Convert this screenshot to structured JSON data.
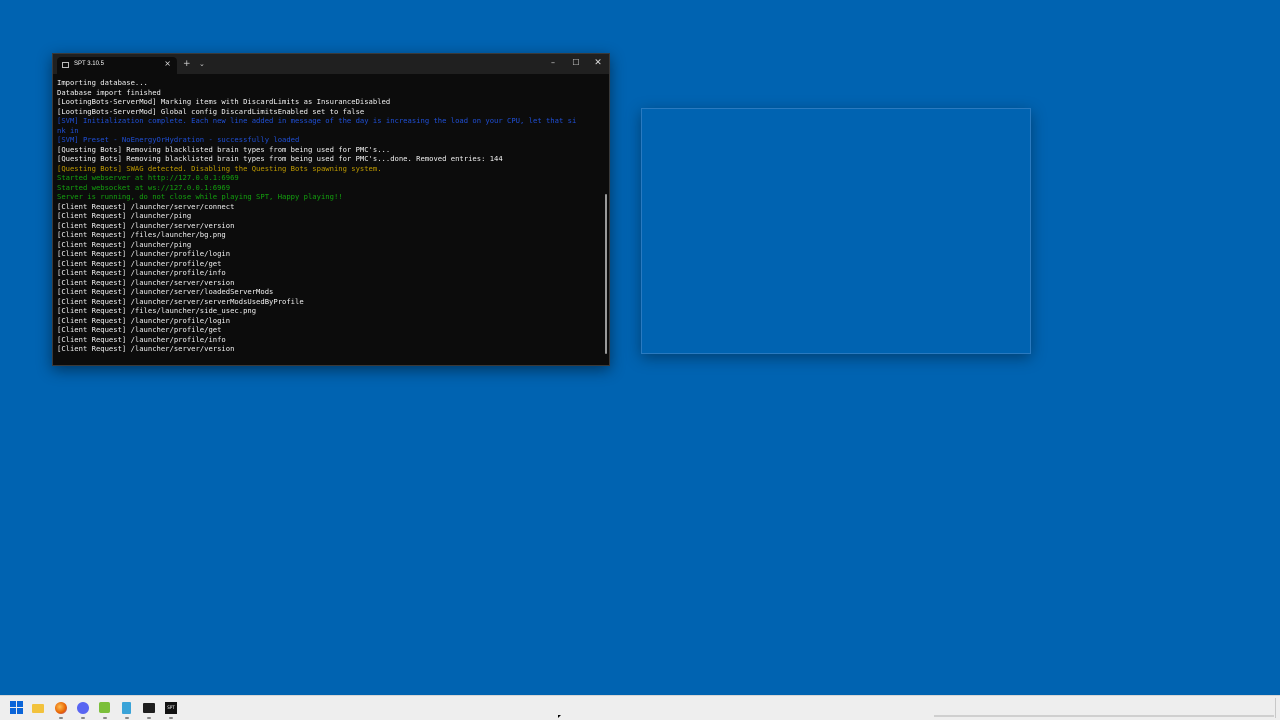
{
  "terminal": {
    "tab_title": "SPT 3.10.5",
    "tab_close": "×",
    "new_tab": "+",
    "dropdown": "⌄",
    "minimize": "–",
    "maximize": "☐",
    "close": "✕",
    "lines": [
      {
        "text": "Importing database...",
        "color": "white"
      },
      {
        "text": "Database import finished",
        "color": "white"
      },
      {
        "text": "[LootingBots-ServerMod] Marking items with DiscardLimits as InsuranceDisabled",
        "color": "white"
      },
      {
        "text": "[LootingBots-ServerMod] Global config DiscardLimitsEnabled set to false",
        "color": "white"
      },
      {
        "text": "[SVM] Initialization complete. Each new line added in message of the day is increasing the load on your CPU, let that si",
        "color": "blue"
      },
      {
        "text": "nk in",
        "color": "blue"
      },
      {
        "text": "[SVM] Preset - NoEnergyOrHydration - successfully loaded",
        "color": "blue"
      },
      {
        "text": "[Questing Bots] Removing blacklisted brain types from being used for PMC's...",
        "color": "white"
      },
      {
        "text": "[Questing Bots] Removing blacklisted brain types from being used for PMC's...done. Removed entries: 144",
        "color": "white"
      },
      {
        "text": "[Questing Bots] SWAG detected. Disabling the Questing Bots spawning system.",
        "color": "yellow"
      },
      {
        "text": "Started webserver at http://127.0.0.1:6969",
        "color": "green"
      },
      {
        "text": "Started websocket at ws://127.0.0.1:6969",
        "color": "green"
      },
      {
        "text": "Server is running, do not close while playing SPT, Happy playing!!",
        "color": "green"
      },
      {
        "text": "[Client Request] /launcher/server/connect",
        "color": "white"
      },
      {
        "text": "[Client Request] /launcher/ping",
        "color": "white"
      },
      {
        "text": "[Client Request] /launcher/server/version",
        "color": "white"
      },
      {
        "text": "[Client Request] /files/launcher/bg.png",
        "color": "white"
      },
      {
        "text": "[Client Request] /launcher/ping",
        "color": "white"
      },
      {
        "text": "[Client Request] /launcher/profile/login",
        "color": "white"
      },
      {
        "text": "[Client Request] /launcher/profile/get",
        "color": "white"
      },
      {
        "text": "[Client Request] /launcher/profile/info",
        "color": "white"
      },
      {
        "text": "[Client Request] /launcher/server/version",
        "color": "white"
      },
      {
        "text": "[Client Request] /launcher/server/loadedServerMods",
        "color": "white"
      },
      {
        "text": "[Client Request] /launcher/server/serverModsUsedByProfile",
        "color": "white"
      },
      {
        "text": "[Client Request] /files/launcher/side_usec.png",
        "color": "white"
      },
      {
        "text": "[Client Request] /launcher/profile/login",
        "color": "white"
      },
      {
        "text": "[Client Request] /launcher/profile/get",
        "color": "white"
      },
      {
        "text": "[Client Request] /launcher/profile/info",
        "color": "white"
      },
      {
        "text": "[Client Request] /launcher/server/version",
        "color": "white"
      }
    ]
  },
  "taskbar": {
    "items": [
      {
        "name": "start-icon"
      },
      {
        "name": "file-explorer-icon"
      },
      {
        "name": "firefox-icon"
      },
      {
        "name": "discord-icon"
      },
      {
        "name": "green-app-icon"
      },
      {
        "name": "notepad-icon"
      },
      {
        "name": "terminal-icon"
      },
      {
        "name": "spt-icon",
        "label": "SPT"
      }
    ]
  },
  "colors": {
    "desktop": "#0063b1",
    "terminal_bg": "#0c0c0c",
    "white_text": "#f2f2f2",
    "blue_text": "#1f4fd6",
    "yellow_text": "#c19c00",
    "green_text": "#13a10e"
  }
}
